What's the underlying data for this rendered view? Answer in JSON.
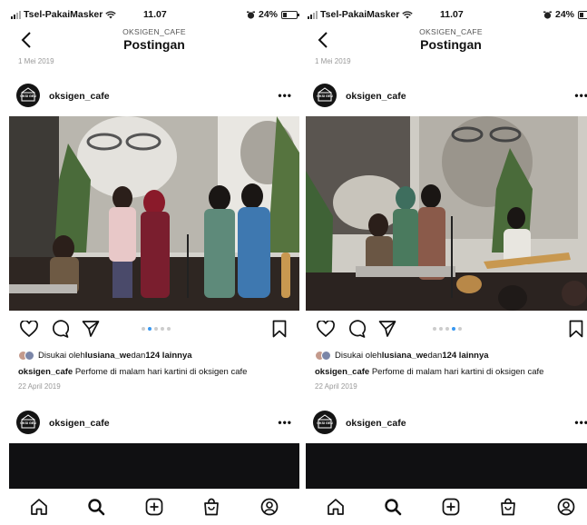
{
  "screens": [
    {
      "status": {
        "carrier": "Tsel-PakaiMasker",
        "time": "11.07",
        "battery": "24%"
      },
      "header": {
        "account": "OKSIGEN_CAFE",
        "title": "Postingan"
      },
      "previous_post_date": "1 Mei 2019",
      "post": {
        "username": "oksigen_cafe",
        "logo_text": "OKSI GEN",
        "more": "•••",
        "carousel": {
          "count": 5,
          "active_index": 1
        },
        "likes": {
          "prefix": "Disukai oleh ",
          "user": "lusiana_we",
          "connector": " dan ",
          "count": "124 lainnya"
        },
        "caption": {
          "username": "oksigen_cafe",
          "text": " Perfome di malam hari kartini di oksigen cafe"
        },
        "date": "22 April 2019"
      },
      "next_post": {
        "username": "oksigen_cafe",
        "logo_text": "OKSI GEN",
        "more": "•••"
      }
    },
    {
      "status": {
        "carrier": "Tsel-PakaiMasker",
        "time": "11.07",
        "battery": "24%"
      },
      "header": {
        "account": "OKSIGEN_CAFE",
        "title": "Postingan"
      },
      "previous_post_date": "1 Mei 2019",
      "post": {
        "username": "oksigen_cafe",
        "logo_text": "OKSI GEN",
        "more": "•••",
        "carousel": {
          "count": 5,
          "active_index": 3
        },
        "likes": {
          "prefix": "Disukai oleh ",
          "user": "lusiana_we",
          "connector": " dan ",
          "count": "124 lainnya"
        },
        "caption": {
          "username": "oksigen_cafe",
          "text": " Perfome di malam hari kartini di oksigen cafe"
        },
        "date": "22 April 2019"
      },
      "next_post": {
        "username": "oksigen_cafe",
        "logo_text": "OKSI GEN",
        "more": "•••"
      }
    }
  ],
  "icons": {
    "back": "chevron-left-icon",
    "like": "heart-icon",
    "comment": "comment-bubble-icon",
    "share": "paper-plane-icon",
    "save": "bookmark-icon",
    "tabs": [
      "home-icon",
      "search-icon",
      "add-post-icon",
      "shop-bag-icon",
      "profile-icon"
    ]
  },
  "colors": {
    "carousel_active": "#3897f0",
    "text": "#111111",
    "muted": "#999999"
  }
}
